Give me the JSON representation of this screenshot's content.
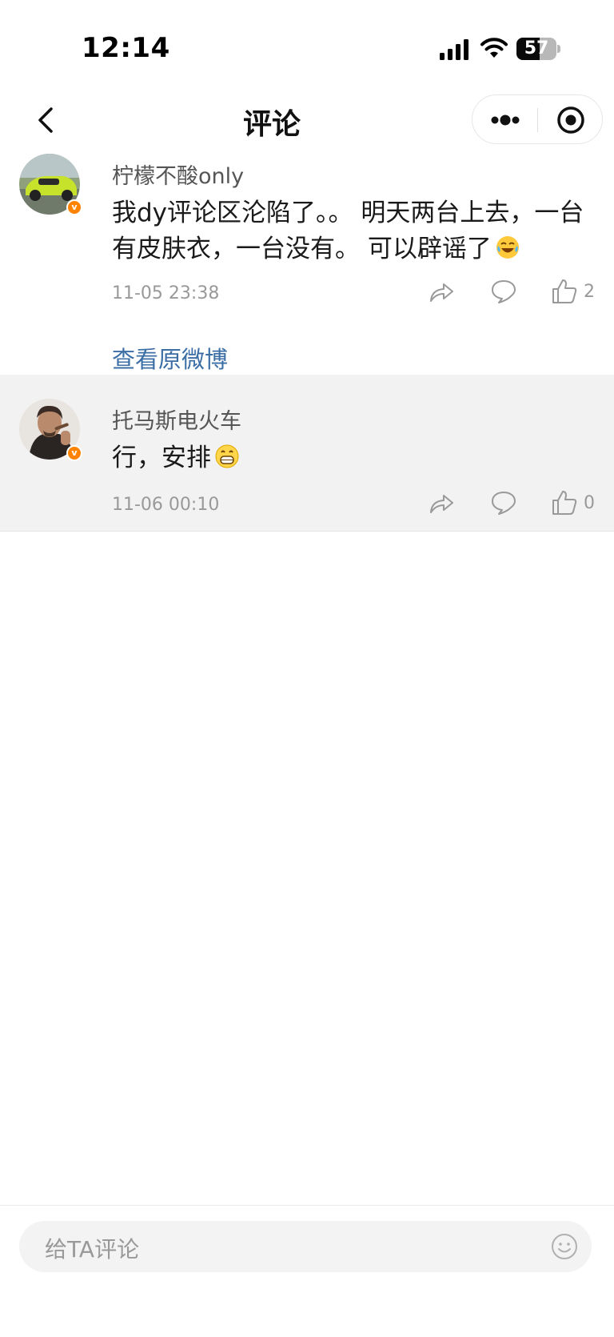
{
  "status_bar": {
    "time": "12:14",
    "battery_level": "57",
    "battery_fraction": 0.57,
    "icons": [
      "cellular-signal-icon",
      "wifi-icon",
      "battery-icon"
    ]
  },
  "nav": {
    "title": "评论",
    "icons": [
      "back-arrow-icon",
      "more-dots-icon",
      "close-target-icon"
    ]
  },
  "comments": [
    {
      "username": "柠檬不酸only",
      "text": "我dy评论区沦陷了。。 明天两台上去，一台有皮肤衣，一台没有。 可以辟谣了",
      "emoji": "laughing-tears-emoji",
      "timestamp": "11-05 23:38",
      "like_count": "2",
      "verified_badge": "v",
      "view_original": "查看原微博"
    },
    {
      "username": "托马斯电火车",
      "text": "行，安排",
      "emoji": "grinning-emoji",
      "timestamp": "11-06 00:10",
      "like_count": "0",
      "verified_badge": "v"
    }
  ],
  "input": {
    "placeholder": "给TA评论",
    "emoji_icon": "smiley-icon"
  },
  "colors": {
    "link": "#3b6ea5",
    "badge": "#ff8200",
    "highlight_bg": "#f2f2f2"
  }
}
